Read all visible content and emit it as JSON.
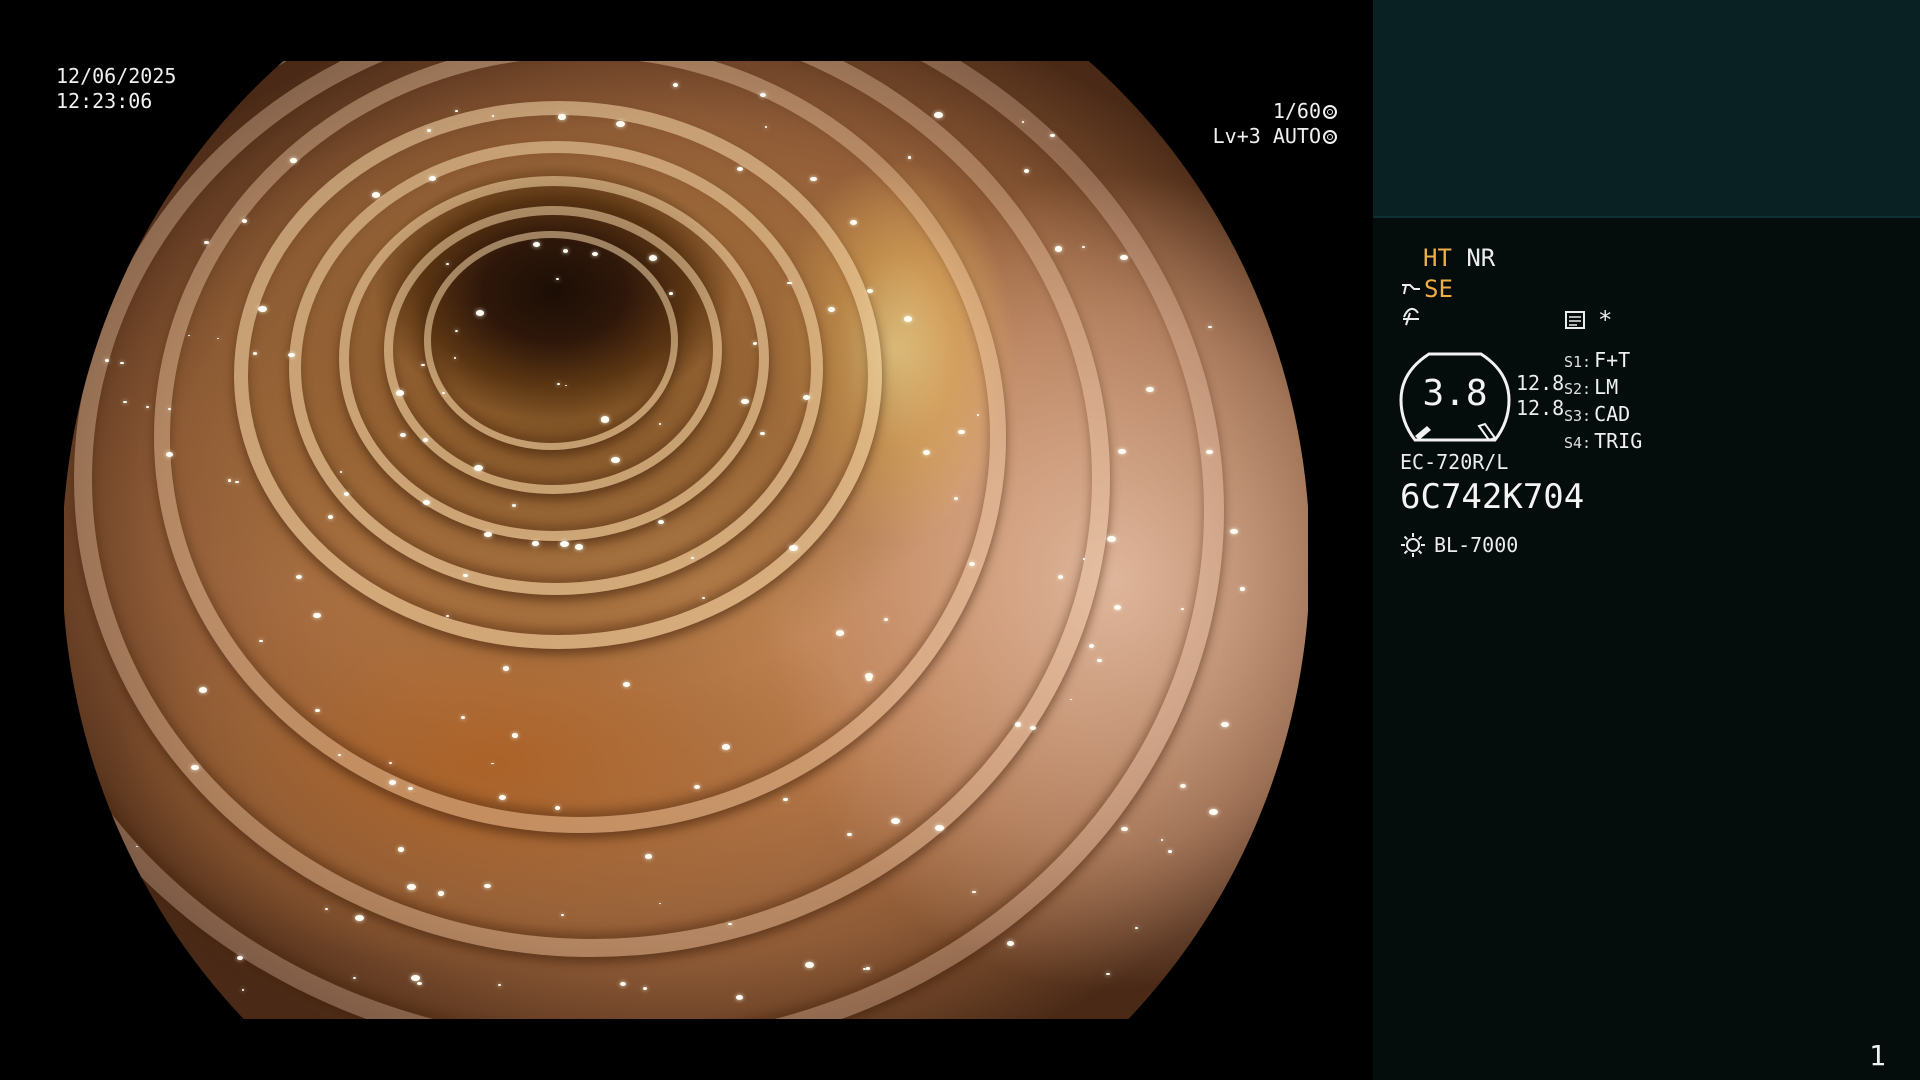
{
  "overlay": {
    "date": "12/06/2025",
    "time": "12:23:06",
    "shutter": "1/60",
    "iris": "Lv+3 AUTO"
  },
  "icons": {
    "shutter_icon": "shutter-dial-icon",
    "iris_icon": "iris-ring-icon",
    "scope_icon": "scope-tip-icon",
    "enhance_icon": "enhance-curve-icon",
    "memo_icon": "memo-card-icon",
    "light_icon": "light-source-icon"
  },
  "panel": {
    "mode_ht": "HT",
    "mode_nr": "NR",
    "mode_se": "SE",
    "asterisk": "*",
    "gauge_value": "3.8",
    "gauge_side": [
      "12.8",
      "12.8"
    ],
    "switches": [
      {
        "key": "S1:",
        "value": "F+T"
      },
      {
        "key": "S2:",
        "value": "LM"
      },
      {
        "key": "S3:",
        "value": "CAD"
      },
      {
        "key": "S4:",
        "value": "TRIG"
      }
    ],
    "scope_model": "EC-720R/L",
    "scope_serial": "6C742K704",
    "light_source": "BL-7000"
  },
  "page_number": "1",
  "colors": {
    "accent_amber": "#f0ae43",
    "panel_bg": "#050c0c",
    "thumb_bg": "#0a2124"
  }
}
